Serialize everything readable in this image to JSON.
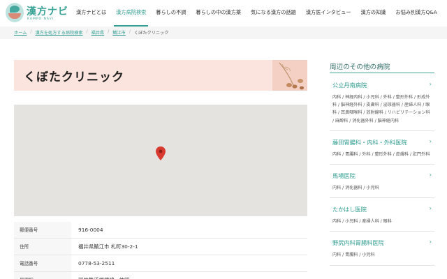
{
  "brand": {
    "name": "漢方ナビ",
    "sub": "KAMPO NAVI"
  },
  "nav": {
    "items": [
      {
        "label": "漢方ナビとは"
      },
      {
        "label": "漢方病院検索"
      },
      {
        "label": "暮らしの不調"
      },
      {
        "label": "暮らしの中の漢方薬"
      },
      {
        "label": "気になる漢方の話題"
      },
      {
        "label": "漢方医インタビュー"
      },
      {
        "label": "漢方の知識"
      },
      {
        "label": "お悩み別漢方Q&A"
      }
    ],
    "active_index": 1
  },
  "breadcrumb": {
    "home": "ホーム",
    "search": "漢方を処方する病院検索",
    "prefecture": "福井県",
    "city": "鯖江市",
    "current": "くぼたクリニック",
    "separator": "/"
  },
  "clinic": {
    "name": "くぼたクリニック"
  },
  "info": {
    "rows": [
      {
        "label": "郵便番号",
        "value": "916-0004"
      },
      {
        "label": "住所",
        "value": "福井県鯖江市 札町30-2-1"
      },
      {
        "label": "電話番号",
        "value": "0778-53-2511"
      },
      {
        "label": "最寄駅",
        "value": "冨井鉄道福武線 · 神明"
      }
    ]
  },
  "sidebar": {
    "heading": "周辺のその他の病院",
    "hospitals": [
      {
        "name": "公立丹南病院",
        "tags": "内科 / 神経内科 / 小児科 / 外科 / 整形外科 / 形成外科 / 脳神経外科 / 皮膚科 / 泌尿器科 / 産婦人科 / 眼科 / 耳鼻咽喉科 / 放射線科 / リハビリテーション科 / 麻酔科 / 消化器外科 / 脳神経内科"
      },
      {
        "name": "藤田胃腸科・内科・外科医院",
        "tags": "内科 / 胃腸科 / 外科 / 整形外科 / 皮膚科 / 肛門外科"
      },
      {
        "name": "馬場医院",
        "tags": "内科 / 消化器科 / 小児科"
      },
      {
        "name": "たかはし医院",
        "tags": "内科 / 小児科 / 産婦人科 / 眼科"
      },
      {
        "name": "野尻内科胃腸科医院",
        "tags": "内科 / 胃腸科 / 小児科"
      }
    ],
    "arrow": "›"
  },
  "colors": {
    "accent": "#2f9d91",
    "title_bg": "#fbe4dd",
    "map_bg": "#e5e3df",
    "pin": "#d93a2f"
  },
  "icons": {
    "map_pin": "map-pin-icon",
    "chevron": "chevron-right-icon"
  }
}
